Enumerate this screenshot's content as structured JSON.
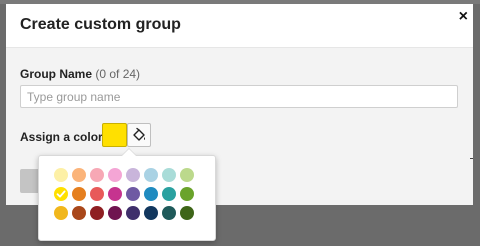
{
  "modal": {
    "title": "Create custom group",
    "close_label": "×"
  },
  "form": {
    "group_name_label": "Group Name",
    "group_name_hint": "(0 of 24)",
    "group_name_value": "",
    "group_name_placeholder": "Type group name",
    "assign_color_label": "Assign a color",
    "selected_color": "#ffe000",
    "submit_label": ""
  },
  "icons": {
    "close": "close-icon",
    "paint": "paint-bucket-icon",
    "check": "check-icon"
  },
  "palette": {
    "rows": [
      [
        "#fdf0a6",
        "#fbb47a",
        "#f7a8b5",
        "#f4a5d5",
        "#c9b5db",
        "#a9d2e4",
        "#a9dcd8",
        "#bcd98c"
      ],
      [
        "#ffe000",
        "#e57f1f",
        "#e85a5a",
        "#c6338f",
        "#6f5aa3",
        "#1f8bc0",
        "#2aa1a0",
        "#6aa32b"
      ],
      [
        "#f1b71c",
        "#a9471a",
        "#8f1f22",
        "#6f1450",
        "#3f2f6b",
        "#12375e",
        "#1f5a5a",
        "#3e6518"
      ]
    ],
    "selected": {
      "row": 1,
      "col": 0
    }
  }
}
